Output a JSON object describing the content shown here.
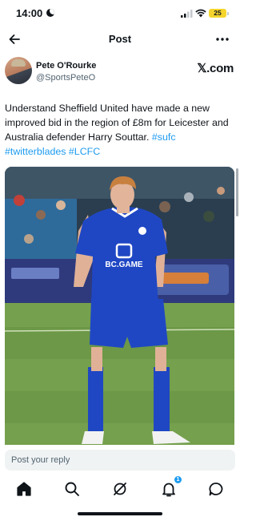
{
  "status_bar": {
    "time": "14:00",
    "battery": "25",
    "icons": [
      "moon-icon",
      "signal-icon",
      "wifi-icon",
      "battery-icon"
    ]
  },
  "header": {
    "title": "Post",
    "icons": [
      "back-arrow-icon",
      "more-options-icon"
    ]
  },
  "author": {
    "name": "Pete O'Rourke",
    "handle": "@SportsPeteO",
    "source_logo": "𝕏.com"
  },
  "tweet": {
    "text": "Understand Sheffield United have made a new improved bid in the region of £8m for Leicester and Australia defender Harry Souttar.",
    "hashtags": [
      "#sufc",
      "#twitterblades",
      "#LCFC"
    ]
  },
  "photo": {
    "shirt_sponsor": "BC.GAME"
  },
  "reply": {
    "placeholder": "Post your reply"
  },
  "bottom_nav": {
    "items": [
      "home-icon",
      "search-icon",
      "grok-icon",
      "notifications-icon",
      "messages-icon"
    ],
    "notification_count": "1"
  },
  "colors": {
    "accent": "#1d9bf0",
    "text_primary": "#0f1419",
    "text_secondary": "#536471",
    "battery": "#f5d52d",
    "kit_blue": "#1f47c4"
  }
}
